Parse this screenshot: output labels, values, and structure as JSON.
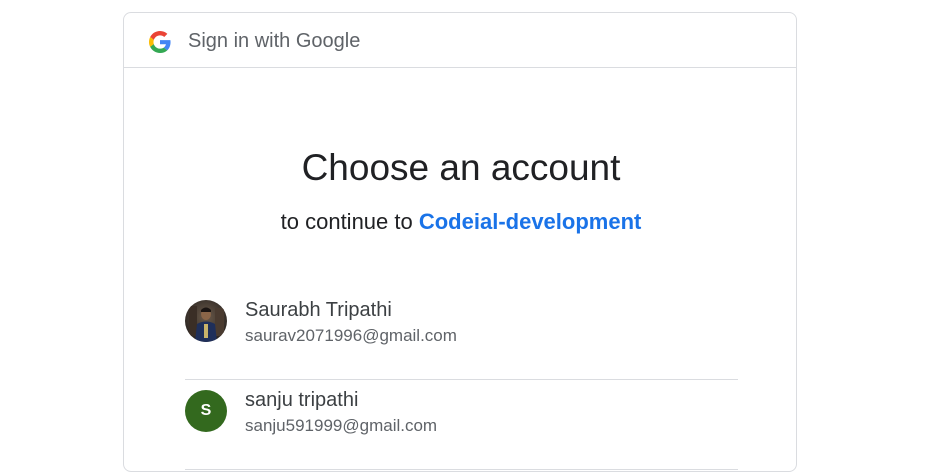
{
  "header": {
    "title": "Sign in with Google",
    "logo_icon": "google-g-logo-icon"
  },
  "main": {
    "title": "Choose an account",
    "subtitle_prefix": "to continue to ",
    "app_name": "Codeial-development"
  },
  "accounts": [
    {
      "name": "Saurabh Tripathi",
      "email": "saurav2071996@gmail.com",
      "avatar": "profile-photo"
    },
    {
      "name": "sanju tripathi",
      "email": "sanju591999@gmail.com",
      "avatar_letter": "S",
      "avatar_color": "#33691e"
    }
  ],
  "colors": {
    "link": "#1a73e8",
    "border": "#dadce0",
    "text_primary": "#202124",
    "text_secondary": "#5f6368"
  }
}
